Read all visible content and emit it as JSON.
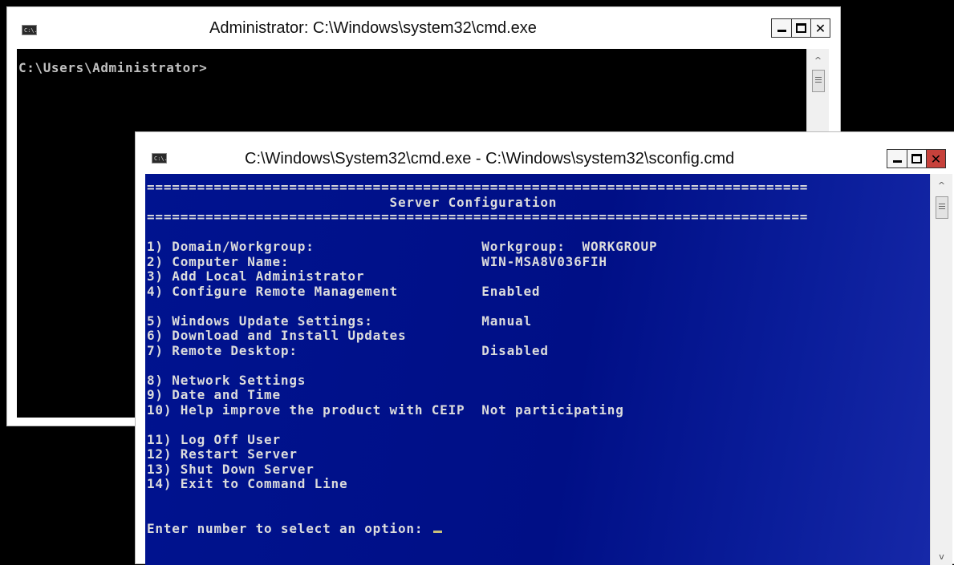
{
  "back_window": {
    "title": "Administrator: C:\\Windows\\system32\\cmd.exe",
    "icon": "cmd-console-icon",
    "icon_label": "C:\\.",
    "console_text": "C:\\Users\\Administrator>",
    "controls": {
      "minimize": "minimize-icon",
      "maximize": "maximize-icon",
      "close": "✕"
    },
    "colors": {
      "console_bg": "#000000",
      "console_fg": "#c0c0c0"
    }
  },
  "front_window": {
    "title": "C:\\Windows\\System32\\cmd.exe - C:\\Windows\\system32\\sconfig.cmd",
    "icon": "cmd-console-icon",
    "icon_label": "C:\\.",
    "controls": {
      "minimize": "minimize-icon",
      "maximize": "maximize-icon",
      "close": "✕"
    },
    "colors": {
      "console_bg": "#000f86",
      "console_fg": "#dcdcdc",
      "close_bg": "#c7413b"
    },
    "console_lines": [
      "===============================================================================",
      "                             Server Configuration",
      "===============================================================================",
      "",
      "1) Domain/Workgroup:                    Workgroup:  WORKGROUP",
      "2) Computer Name:                       WIN-MSA8V036FIH",
      "3) Add Local Administrator",
      "4) Configure Remote Management          Enabled",
      "",
      "5) Windows Update Settings:             Manual",
      "6) Download and Install Updates",
      "7) Remote Desktop:                      Disabled",
      "",
      "8) Network Settings",
      "9) Date and Time",
      "10) Help improve the product with CEIP  Not participating",
      "",
      "11) Log Off User",
      "12) Restart Server",
      "13) Shut Down Server",
      "14) Exit to Command Line",
      "",
      "",
      "Enter number to select an option: "
    ]
  }
}
